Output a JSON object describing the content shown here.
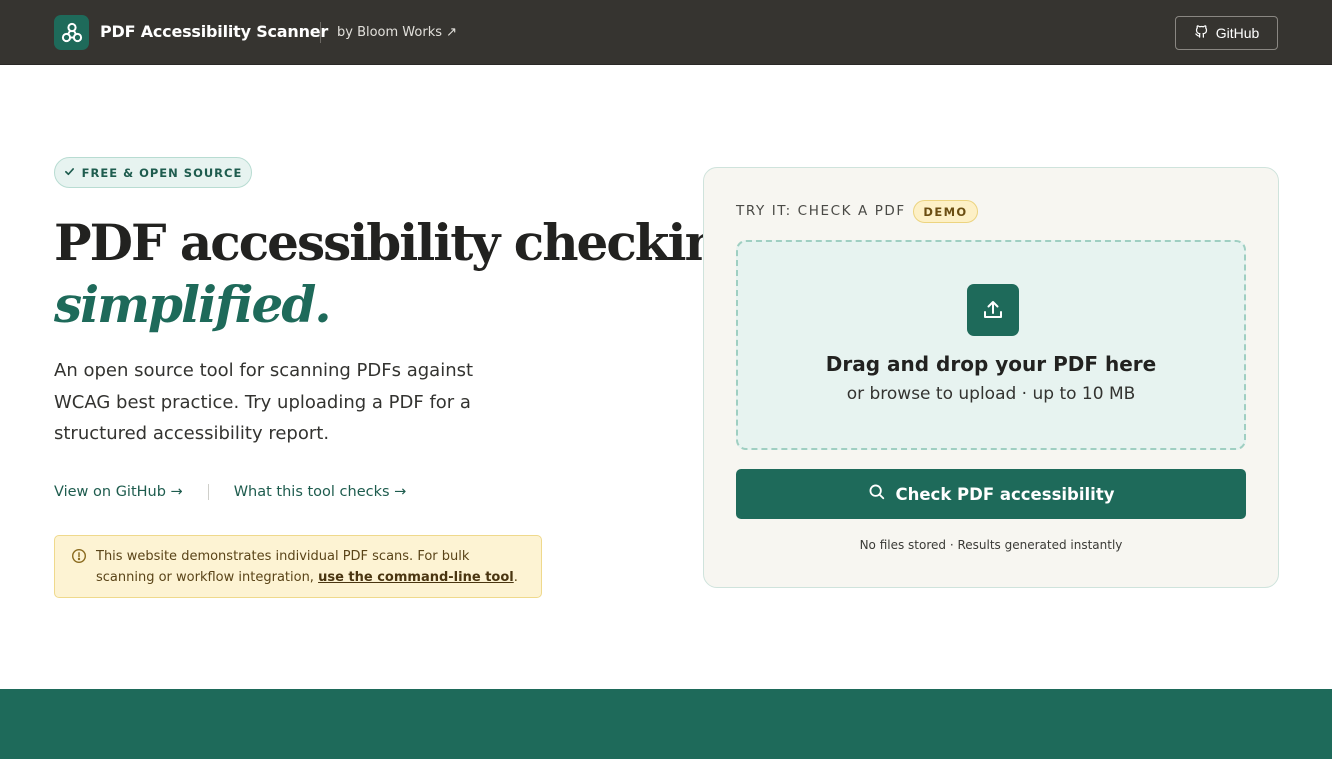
{
  "header": {
    "brand_name": "PDF Accessibility Scanner",
    "by_link": "by Bloom Works ↗",
    "github_button": "GitHub",
    "icons": {
      "logo": "tri-circle-logo-icon",
      "github": "github-icon"
    }
  },
  "hero": {
    "badge": "FREE & OPEN SOURCE",
    "headline_line1": "PDF accessibility checking,",
    "headline_line2": "simplified.",
    "lead": "An open source tool for scanning PDFs against WCAG best practice. Try uploading a PDF for a structured accessibility report.",
    "links": {
      "github": "View on GitHub →",
      "checks": "What this tool checks →"
    },
    "notice": {
      "text_before": "This website demonstrates individual PDF scans. For bulk scanning or workflow integration, ",
      "link": "use the command-line tool",
      "text_after": "."
    }
  },
  "card": {
    "label": "TRY IT: CHECK A PDF",
    "demo_badge": "DEMO",
    "dropzone": {
      "title": "Drag and drop your PDF here",
      "subtitle": "or browse to upload · up to 10 MB"
    },
    "check_button": "Check PDF accessibility",
    "footnote": "No files stored · Results generated instantly"
  },
  "colors": {
    "header_bg": "#363430",
    "brand_green": "#1e6a5a",
    "mint_bg": "#e7f3f0",
    "notice_bg": "#fdf3d3",
    "card_bg": "#f7f6f1"
  }
}
